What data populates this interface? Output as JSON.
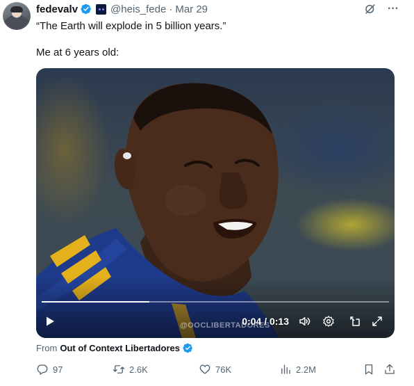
{
  "post": {
    "display_name": "fedevalv",
    "handle": "@heis_fede",
    "separator": "·",
    "date": "Mar 29",
    "quote_line": "“The Earth will explode in 5 billion years.”",
    "caption_line": "Me at 6 years old:"
  },
  "video": {
    "time_current": "0:04",
    "time_total": "0:13",
    "time_display": "0:04 / 0:13",
    "progress_fraction": 0.31,
    "watermark": "@OOCLIBERTADORES"
  },
  "source": {
    "prefix": "From",
    "name": "Out of Context Libertadores"
  },
  "actions": {
    "replies": "97",
    "reposts": "2.6K",
    "likes": "76K",
    "views": "2.2M"
  },
  "icons": {
    "verified": "verified-badge-icon",
    "affiliate": "affiliate-badge-icon",
    "grok": "grok-icon",
    "more": "more-options-icon",
    "play": "play-icon",
    "volume": "volume-icon",
    "settings": "settings-gear-icon",
    "skip": "skip-forward-icon",
    "fullscreen": "fullscreen-icon",
    "reply": "reply-icon",
    "repost": "repost-icon",
    "like": "heart-icon",
    "views": "views-chart-icon",
    "bookmark": "bookmark-icon",
    "share": "share-icon"
  },
  "colors": {
    "accent": "#1d9bf0",
    "text_primary": "#0f1419",
    "text_secondary": "#536471"
  }
}
